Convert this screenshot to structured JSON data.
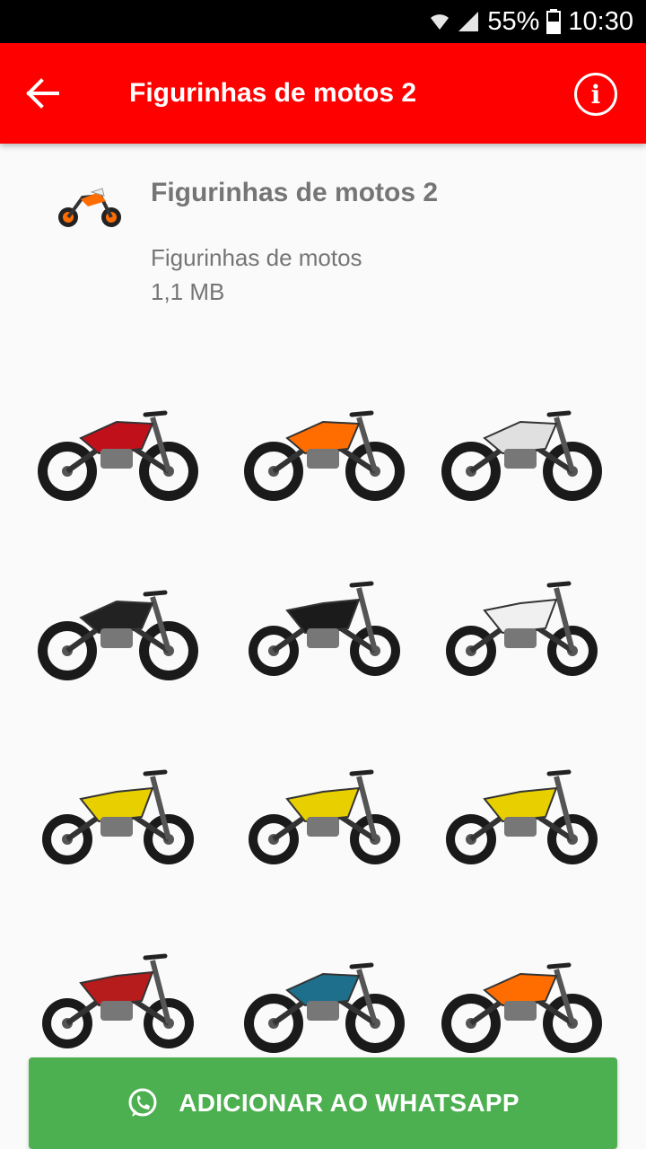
{
  "status_bar": {
    "battery": "55%",
    "time": "10:30",
    "icons": [
      "wifi-icon",
      "signal-icon",
      "battery-icon"
    ]
  },
  "app_bar": {
    "title": "Figurinhas de motos 2",
    "back_icon": "arrow-left-icon",
    "info_icon": "info-icon",
    "color": "#ff0000"
  },
  "pack": {
    "name": "Figurinhas de motos 2",
    "publisher": "Figurinhas de motos",
    "size": "1,1 MB"
  },
  "stickers": [
    {
      "name": "red-street-motorcycle",
      "color": "#c0111b"
    },
    {
      "name": "orange-naked-motorcycle",
      "color": "#ff6d00"
    },
    {
      "name": "white-sport-motorcycle",
      "color": "#e0e0e0"
    },
    {
      "name": "black-cruiser-motorcycle",
      "color": "#222222"
    },
    {
      "name": "black-dirt-bike",
      "color": "#1b1b1b"
    },
    {
      "name": "black-white-dirt-bike",
      "color": "#f0f0f0"
    },
    {
      "name": "yellow-dirt-bike-1",
      "color": "#e8d000"
    },
    {
      "name": "yellow-dirt-bike-2",
      "color": "#e8d000"
    },
    {
      "name": "yellow-dirt-bike-3",
      "color": "#e8d000"
    },
    {
      "name": "red-black-dirt-bike",
      "color": "#b71c1c"
    },
    {
      "name": "blue-adventure-motorcycle",
      "color": "#1e6f8c"
    },
    {
      "name": "white-orange-naked-motorcycle",
      "color": "#ff6d00"
    }
  ],
  "add_button": {
    "label": "ADICIONAR AO WHATSAPP",
    "icon": "whatsapp-icon",
    "color": "#4caf50"
  }
}
